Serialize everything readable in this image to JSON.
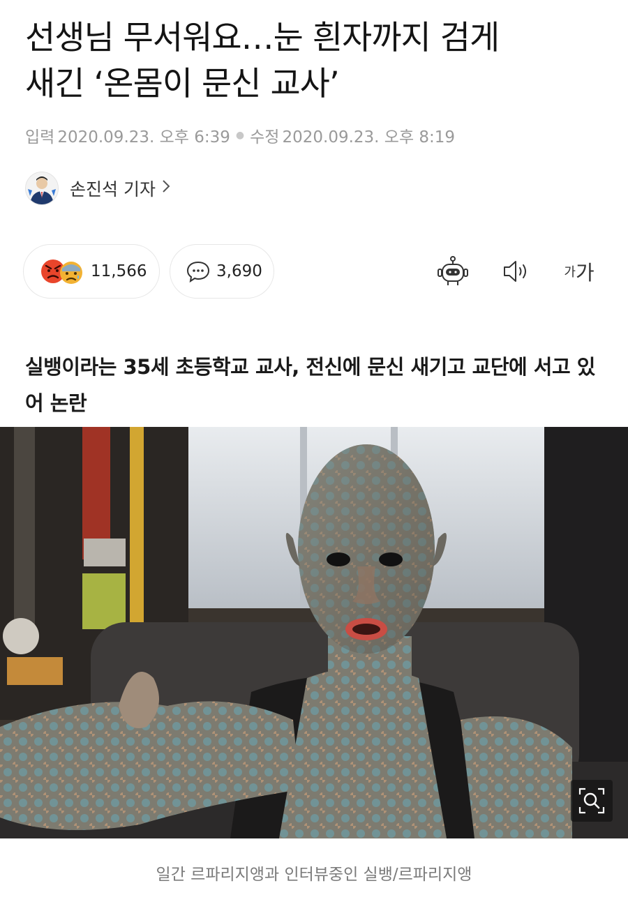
{
  "article": {
    "headline_line1": "선생님 무서워요…눈 흰자까지 검게",
    "headline_line2": "새긴 ‘온몸이 문신 교사’",
    "published_label": "입력",
    "published": "2020.09.23. 오후 6:39",
    "modified_label": "수정",
    "modified": "2020.09.23. 오후 8:19",
    "reporter": "손진석 기자",
    "subtitle": "실뱅이라는 35세 초등학교 교사, 전신에 문신 새기고 교단에 서고 있어 논란",
    "photo_caption": "일간 르파리지앵과 인터뷰중인 실뱅/르파리지앵"
  },
  "toolbar": {
    "reaction_count": "11,566",
    "comment_count": "3,690",
    "font_small": "가",
    "font_big": "가"
  },
  "icons": {
    "reaction": [
      "angry-face-icon",
      "sad-face-icon"
    ],
    "comment": "speech-bubble-icon",
    "bot": "robot-summary-icon",
    "speaker": "speaker-icon",
    "zoom": "magnifier-zoom-icon",
    "chevron": "chevron-right-icon"
  },
  "colors": {
    "angry": "#e9452b",
    "sad": "#f2b233",
    "meta_text": "#9a9a9a"
  }
}
